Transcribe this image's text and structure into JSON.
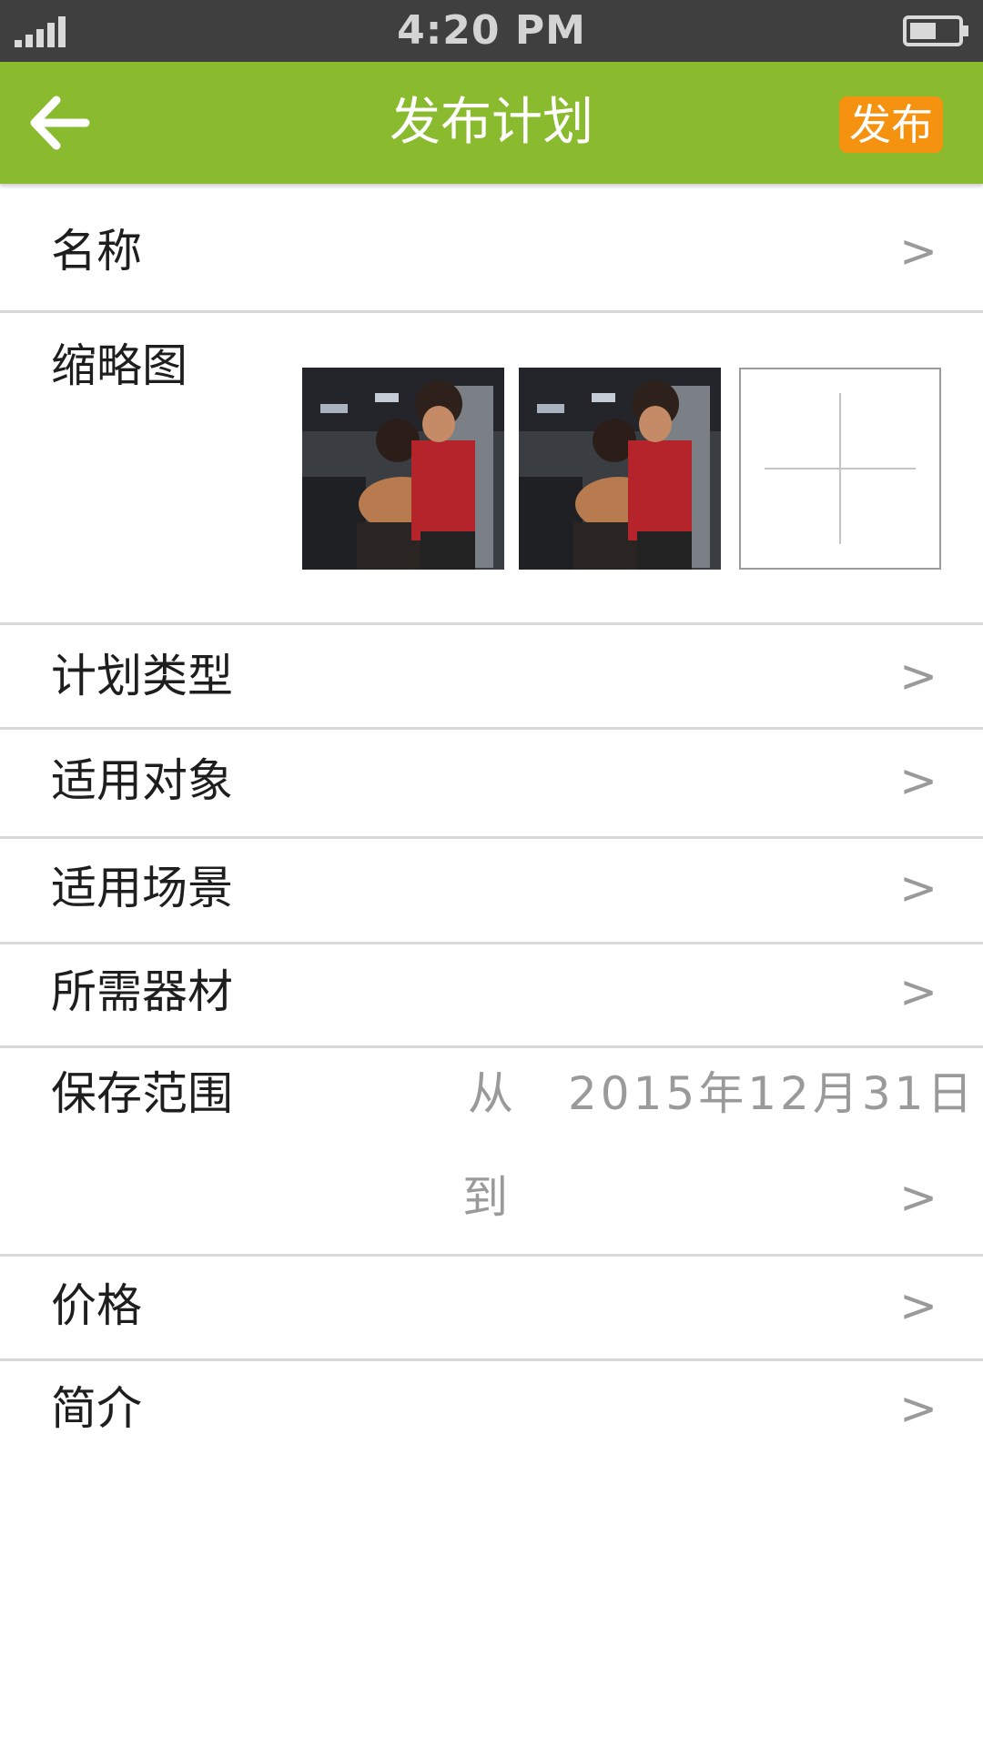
{
  "status_bar": {
    "time": "4:20 PM"
  },
  "header": {
    "title": "发布计划",
    "publish_label": "发布",
    "accent_color": "#8aba2e",
    "publish_color": "#f5920f"
  },
  "form": {
    "chevron": ">",
    "name_label": "名称",
    "thumbnail_label": "缩略图",
    "plan_type_label": "计划类型",
    "target_label": "适用对象",
    "scene_label": "适用场景",
    "equipment_label": "所需器材",
    "save_range": {
      "label": "保存范围",
      "from_label": "从",
      "from_date": "2015年12月31日",
      "to_label": "到"
    },
    "price_label": "价格",
    "intro_label": "简介"
  },
  "icons": {
    "back": "arrow-left-icon",
    "add": "plus-icon",
    "signal": "signal-icon",
    "battery": "battery-icon"
  }
}
